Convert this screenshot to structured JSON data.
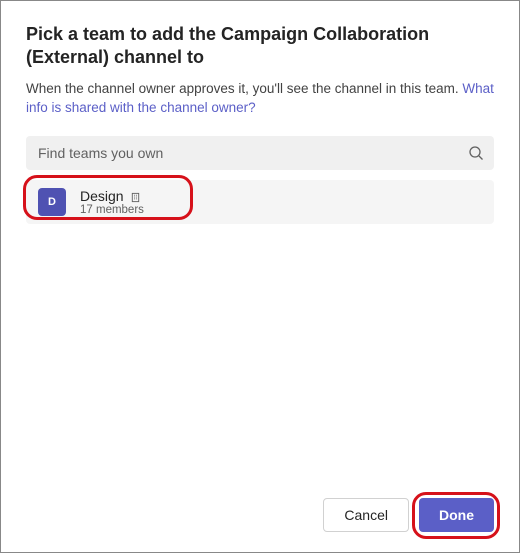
{
  "dialog": {
    "title": "Pick a team to add the Campaign Collaboration (External) channel to",
    "subtitle_prefix": "When the channel owner approves it, you'll see the channel in this team. ",
    "link_text": "What info is shared with the channel owner?"
  },
  "search": {
    "placeholder": "Find teams you own",
    "value": ""
  },
  "teams": {
    "item0": {
      "avatar_initial": "D",
      "name": "Design",
      "meta": "17 members"
    }
  },
  "footer": {
    "cancel_label": "Cancel",
    "done_label": "Done"
  },
  "colors": {
    "primary": "#5b5fc7",
    "annotation": "#d6111a"
  }
}
